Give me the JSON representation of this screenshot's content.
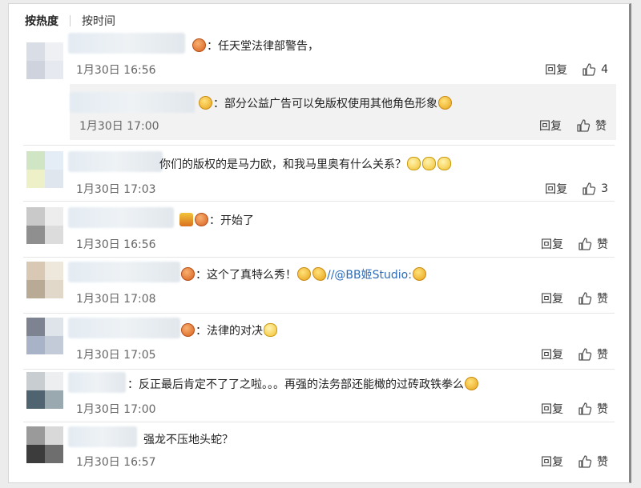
{
  "tabs": {
    "hot": "按热度",
    "time": "按时间"
  },
  "actions": {
    "reply": "回复",
    "like": "赞"
  },
  "comments": [
    {
      "text": "：任天堂法律部警告，",
      "time": "1月30日 16:56",
      "likes": "4"
    },
    {
      "text": "：部分公益广告可以免版权使用其他角色形象",
      "time": "1月30日 17:00",
      "likes": "赞"
    },
    {
      "text": "你们的版权的是马力欧，和我马里奥有什么关系？",
      "time": "1月30日 17:03",
      "likes": "3"
    },
    {
      "text": "：开始了",
      "time": "1月30日 16:56",
      "likes": "赞"
    },
    {
      "text": "：这个了真特么秀！",
      "mention": "//@BB姬Studio:",
      "time": "1月30日 17:08",
      "likes": "赞"
    },
    {
      "text": "：法律的对决",
      "time": "1月30日 17:05",
      "likes": "赞"
    },
    {
      "text": "：反正最后肯定不了了之啦。。。再强的法务部还能橄的过砖政铁拳么",
      "time": "1月30日 17:00",
      "likes": "赞"
    },
    {
      "text": "强龙不压地头蛇？",
      "time": "1月30日 16:57",
      "likes": "赞"
    }
  ],
  "colors": {
    "link": "#2a6bb8",
    "text": "#222222",
    "meta": "#666666",
    "sub_bg": "#f2f2f2"
  }
}
